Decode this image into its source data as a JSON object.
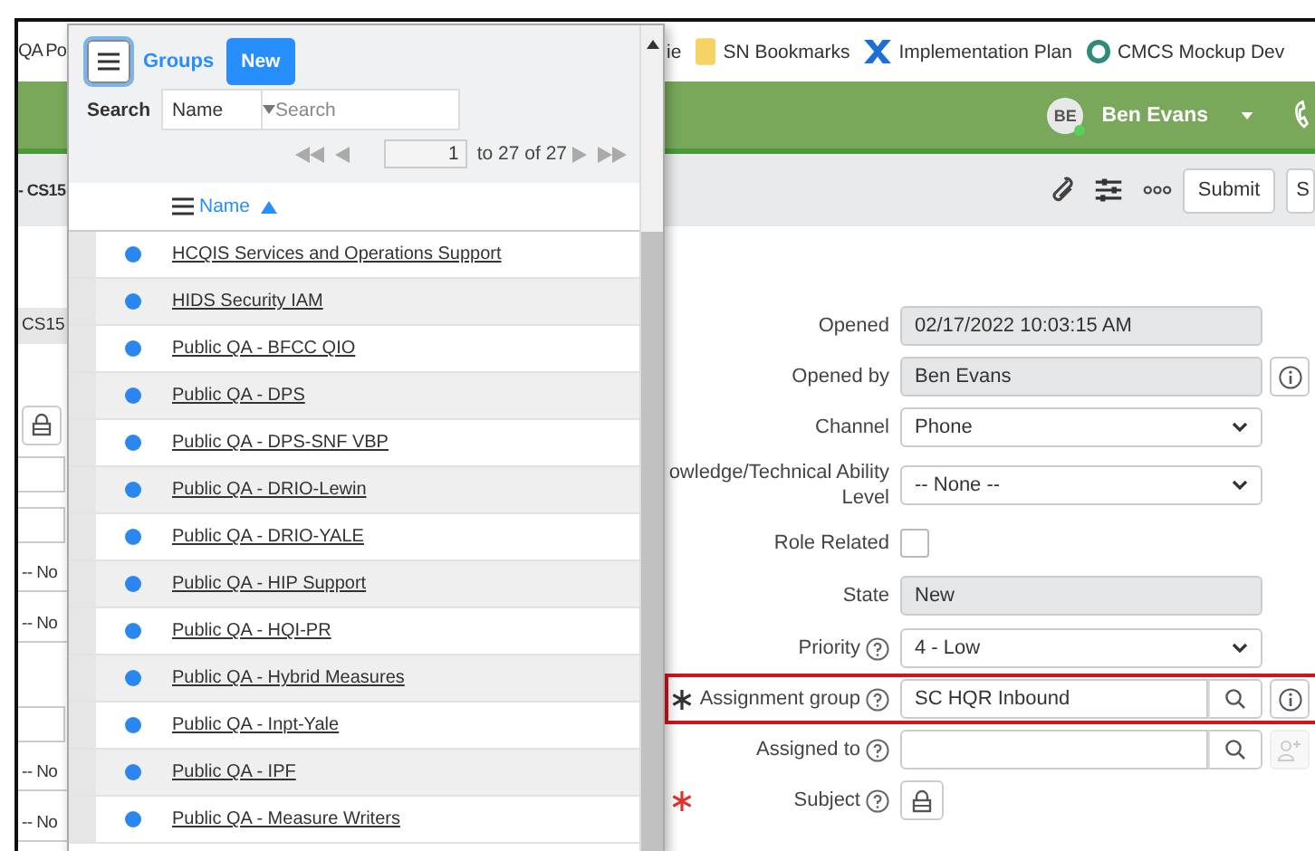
{
  "bookmarks": {
    "left": "QA Po",
    "items": [
      {
        "label": "ie",
        "kind": "plain"
      },
      {
        "label": "SN Bookmarks",
        "kind": "folder"
      },
      {
        "label": "Implementation Plan",
        "kind": "cross"
      },
      {
        "label": "CMCS Mockup Dev",
        "kind": "ring"
      }
    ]
  },
  "header": {
    "user": {
      "initials": "BE",
      "name": "Ben Evans",
      "online": true
    }
  },
  "toolbar": {
    "title": "- CS15",
    "buttons": [
      "Submit",
      "S"
    ]
  },
  "left_fields": [
    {
      "kind": "text",
      "value": "CS15"
    },
    {
      "kind": "spacer"
    },
    {
      "kind": "lock"
    },
    {
      "kind": "empty"
    },
    {
      "kind": "empty"
    },
    {
      "kind": "select",
      "value": "-- No"
    },
    {
      "kind": "select",
      "value": "-- No"
    },
    {
      "kind": "spacer"
    },
    {
      "kind": "empty"
    },
    {
      "kind": "select",
      "value": "-- No"
    },
    {
      "kind": "select",
      "value": "-- No"
    }
  ],
  "form": [
    {
      "label": [
        "Opened"
      ],
      "help": false,
      "required": false,
      "highlighted": false,
      "info": false,
      "kind": "readonly",
      "value": "02/17/2022 10:03:15 AM"
    },
    {
      "label": [
        "Opened by"
      ],
      "help": false,
      "required": false,
      "highlighted": false,
      "info": true,
      "kind": "readonly",
      "value": "Ben Evans"
    },
    {
      "label": [
        "Channel"
      ],
      "help": false,
      "required": false,
      "highlighted": false,
      "info": false,
      "kind": "select",
      "value": "Phone"
    },
    {
      "label": [
        "owledge/Technical Ability",
        "Level"
      ],
      "help": false,
      "required": false,
      "highlighted": false,
      "info": false,
      "kind": "select",
      "value": "-- None --"
    },
    {
      "label": [
        "Role Related"
      ],
      "help": false,
      "required": false,
      "highlighted": false,
      "info": false,
      "kind": "checkbox",
      "checked": false
    },
    {
      "label": [
        "State"
      ],
      "help": false,
      "required": false,
      "highlighted": false,
      "info": false,
      "kind": "readonly",
      "value": "New"
    },
    {
      "label": [
        "Priority"
      ],
      "help": true,
      "required": false,
      "highlighted": false,
      "info": false,
      "kind": "select",
      "value": "4 - Low"
    },
    {
      "label": [
        "Assignment group"
      ],
      "help": true,
      "required": true,
      "required_filled": true,
      "highlighted": true,
      "info": true,
      "kind": "reference",
      "value": "SC HQR Inbound"
    },
    {
      "label": [
        "Assigned to"
      ],
      "help": true,
      "required": false,
      "highlighted": false,
      "info": false,
      "kind": "reference",
      "add_user_disabled": true
    },
    {
      "label": [
        "Subject"
      ],
      "help": true,
      "required": true,
      "required_filled": false,
      "highlighted": false,
      "info": false,
      "kind": "lock"
    }
  ],
  "popup": {
    "menu_focused": true,
    "title": "Groups",
    "new_button": "New",
    "search": {
      "label": "Search",
      "field": "Name",
      "placeholder": "Search"
    },
    "pager": {
      "page": "1",
      "range": "to 27 of 27"
    },
    "column": "Name",
    "rows": [
      {
        "name": "HCQIS Services and Operations Support"
      },
      {
        "name": "HIDS Security IAM"
      },
      {
        "name": "Public QA - BFCC QIO"
      },
      {
        "name": "Public QA - DPS"
      },
      {
        "name": "Public QA - DPS-SNF VBP"
      },
      {
        "name": "Public QA - DRIO-Lewin"
      },
      {
        "name": "Public QA - DRIO-YALE"
      },
      {
        "name": "Public QA - HIP Support"
      },
      {
        "name": "Public QA - HQI-PR"
      },
      {
        "name": "Public QA - Hybrid Measures"
      },
      {
        "name": "Public QA - Inpt-Yale"
      },
      {
        "name": "Public QA - IPF"
      },
      {
        "name": "Public QA - Measure Writers"
      }
    ]
  }
}
